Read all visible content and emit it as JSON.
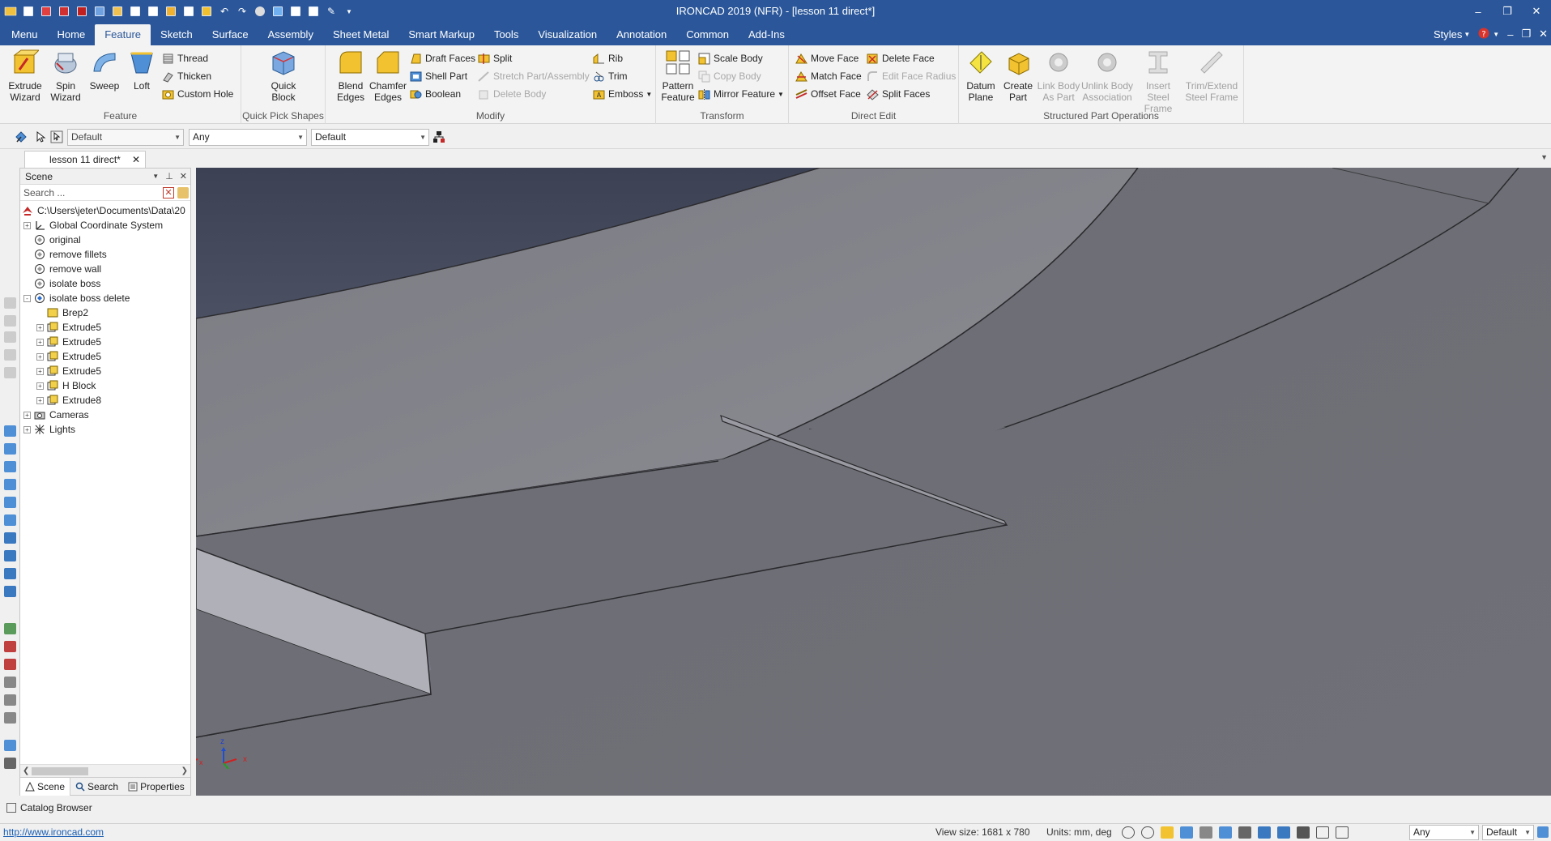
{
  "window": {
    "title": "IRONCAD 2019 (NFR) - [lesson 11 direct*]",
    "controls": [
      "–",
      "❐",
      "✕"
    ]
  },
  "ribbon_tabs": [
    "Menu",
    "Home",
    "Feature",
    "Sketch",
    "Surface",
    "Assembly",
    "Sheet Metal",
    "Smart Markup",
    "Tools",
    "Visualization",
    "Annotation",
    "Common",
    "Add-Ins"
  ],
  "ribbon_right": {
    "styles_label": "Styles",
    "window_controls": [
      "–",
      "❐",
      "✕"
    ]
  },
  "ribbon": {
    "feature_group": {
      "label": "Feature",
      "extrude": "Extrude Wizard",
      "spin": "Spin Wizard",
      "sweep": "Sweep",
      "loft": "Loft",
      "thread": "Thread",
      "thicken": "Thicken",
      "custom_hole": "Custom Hole"
    },
    "quickpick_group": {
      "label": "Quick Pick Shapes",
      "quick_block": "Quick Block"
    },
    "modify_group": {
      "label": "Modify",
      "blend": "Blend Edges",
      "chamfer": "Chamfer Edges",
      "draft": "Draft Faces",
      "shell": "Shell Part",
      "boolean": "Boolean",
      "split": "Split",
      "stretch": "Stretch Part/Assembly",
      "delete_body": "Delete Body",
      "rib": "Rib",
      "trim": "Trim",
      "emboss": "Emboss"
    },
    "transform_group": {
      "label": "Transform",
      "pattern": "Pattern Feature",
      "scale": "Scale Body",
      "copy": "Copy Body",
      "mirror": "Mirror Feature"
    },
    "direct_edit_group": {
      "label": "Direct Edit",
      "move_face": "Move Face",
      "match_face": "Match Face",
      "offset_face": "Offset Face",
      "delete_face": "Delete Face",
      "edit_radius": "Edit Face Radius",
      "split_faces": "Split Faces"
    },
    "structured_group": {
      "label": "Structured Part Operations",
      "datum": "Datum Plane",
      "create_part": "Create Part",
      "link_body": "Link Body As Part",
      "unlink_body": "Unlink Body Association",
      "insert_steel": "Insert Steel Frame",
      "trim_steel": "Trim/Extend Steel Frame"
    }
  },
  "toolbar2": {
    "select1": "Default",
    "select2": "Any",
    "select3": "Default"
  },
  "doc_tab": {
    "label": "lesson 11 direct*"
  },
  "scene": {
    "title": "Scene",
    "search_placeholder": "Search ...",
    "root": "C:\\Users\\jeter\\Documents\\Data\\20",
    "nodes": [
      {
        "label": "Global Coordinate System",
        "level": 1,
        "expander": "+"
      },
      {
        "label": "original",
        "level": 1,
        "expander": ""
      },
      {
        "label": "remove fillets",
        "level": 1,
        "expander": ""
      },
      {
        "label": "remove wall",
        "level": 1,
        "expander": ""
      },
      {
        "label": "isolate boss",
        "level": 1,
        "expander": ""
      },
      {
        "label": "isolate boss delete",
        "level": 1,
        "expander": "-"
      },
      {
        "label": "Brep2",
        "level": 2,
        "expander": ""
      },
      {
        "label": "Extrude5",
        "level": 2,
        "expander": "+"
      },
      {
        "label": "Extrude5",
        "level": 2,
        "expander": "+"
      },
      {
        "label": "Extrude5",
        "level": 2,
        "expander": "+"
      },
      {
        "label": "Extrude5",
        "level": 2,
        "expander": "+"
      },
      {
        "label": "H Block",
        "level": 2,
        "expander": "+"
      },
      {
        "label": "Extrude8",
        "level": 2,
        "expander": "+"
      },
      {
        "label": "Cameras",
        "level": 1,
        "expander": "+"
      },
      {
        "label": "Lights",
        "level": 1,
        "expander": "+"
      }
    ],
    "tabs": [
      "Scene",
      "Search",
      "Properties"
    ]
  },
  "catalog_browser": "Catalog Browser",
  "triad": {
    "z": "z",
    "x": "x"
  },
  "statusbar": {
    "url": "http://www.ironcad.com",
    "view_size": "View size: 1681 x 780",
    "units": "Units: mm, deg",
    "select1": "Any",
    "select2": "Default"
  }
}
